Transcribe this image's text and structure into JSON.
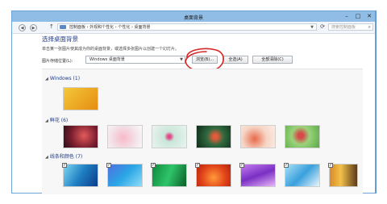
{
  "window": {
    "title": "桌面背景",
    "minimize": "–",
    "maximize": "□",
    "close": "✕"
  },
  "address_bar": {
    "path": "控制面板 › 外观和个性化 › 个性化 › 桌面背景",
    "search_placeholder": "搜索控制面板"
  },
  "page": {
    "heading": "选择桌面背景",
    "instruction": "单击某一张图片使其成为你的桌面背景，或选择多张图片以创建一个幻灯片。",
    "location_label": "图片存储位置(L):",
    "location_value": "Windows 桌面背景",
    "browse_label": "浏览(B)...",
    "select_all_label": "全选(A)",
    "clear_all_label": "全部清除(C)"
  },
  "groups": [
    {
      "name": "Windows (1)"
    },
    {
      "name": "鲜花 (6)"
    },
    {
      "name": "线条和颜色 (7)"
    }
  ],
  "colors": {
    "accent": "#1e3a8a",
    "titlebar": "#8fbde6",
    "annotation": "#d62828"
  },
  "icons": [
    "back-icon",
    "forward-icon",
    "up-arrow-icon",
    "folder-icon",
    "refresh-icon",
    "search-icon"
  ]
}
